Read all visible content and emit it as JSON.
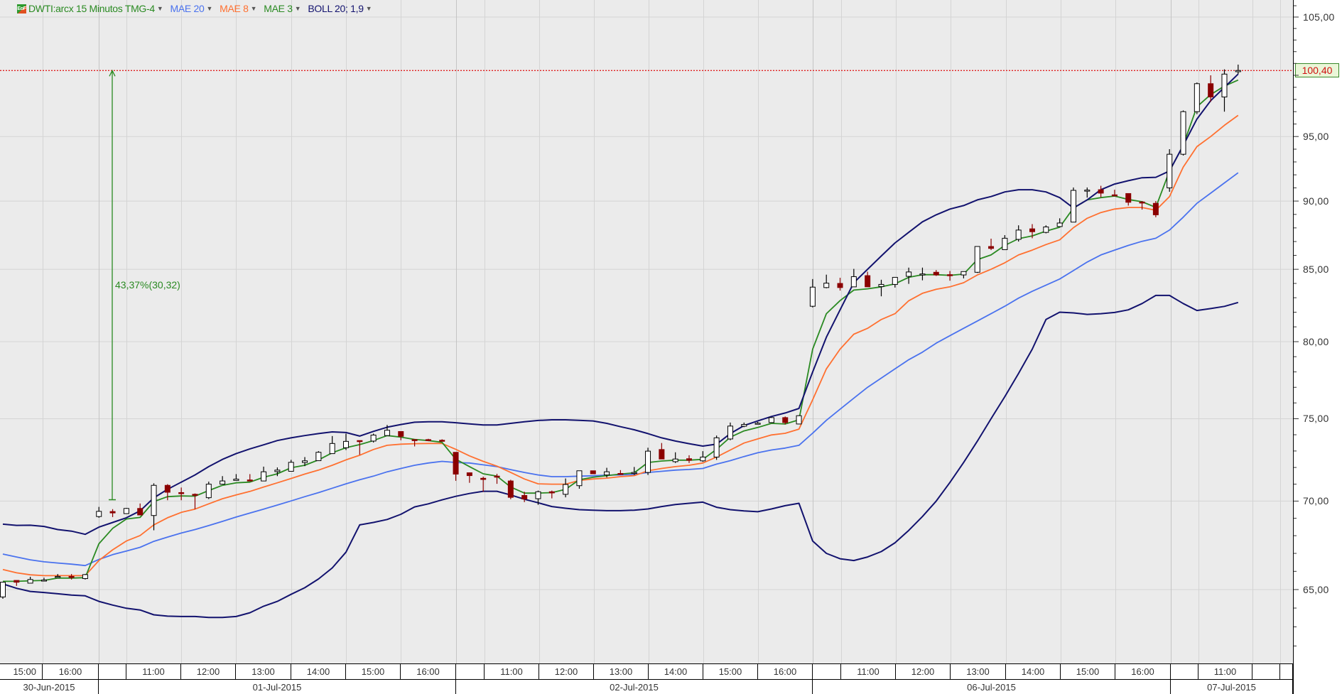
{
  "legend": {
    "symbol": "DWTI:arcx 15 Minutos TMG-4",
    "icon": "eof-logo-icon",
    "icon_text": "EoF",
    "indicators": [
      {
        "label": "MAE 20",
        "color": "#4a72ee"
      },
      {
        "label": "MAE 8",
        "color": "#ff7030"
      },
      {
        "label": "MAE 3",
        "color": "#2a8a22"
      },
      {
        "label": "BOLL 20; 1,9",
        "color": "#12126e"
      }
    ],
    "symbol_color": "#2a8a22"
  },
  "last_price": {
    "value": 100.4,
    "label": "100,40",
    "line_color": "#e02020"
  },
  "annotation": {
    "label": "43,37%(30,32)",
    "from": 70.08,
    "to": 100.4,
    "color": "#2a8a22"
  },
  "chart_data": {
    "type": "candlestick",
    "title": "DWTI:arcx 15 Minutos TMG-4",
    "yscale": "log",
    "ylim": [
      60.5,
      107.5
    ],
    "y_ticks": [
      105,
      100,
      95,
      90,
      85,
      80,
      75,
      70,
      65
    ],
    "y_tick_labels": [
      "105,00",
      "",
      "95,00",
      "90,00",
      "85,00",
      "80,00",
      "75,00",
      "70,00",
      "65,00"
    ],
    "grid": true,
    "x_hour_labels": [
      "15:00",
      "16:00",
      "",
      "11:00",
      "12:00",
      "13:00",
      "14:00",
      "15:00",
      "16:00",
      "",
      "11:00",
      "12:00",
      "13:00",
      "14:00",
      "15:00",
      "16:00",
      "",
      "11:00",
      "12:00",
      "13:00",
      "14:00",
      "15:00",
      "16:00",
      "",
      "11:00",
      "",
      ""
    ],
    "x_day_labels": [
      "30-Jun-2015",
      "01-Jul-2015",
      "02-Jul-2015",
      "06-Jul-2015",
      "07-Jul-2015",
      ""
    ],
    "candles_ohlc": [
      [
        64.6,
        65.4,
        64.5,
        65.4
      ],
      [
        65.5,
        65.5,
        65.2,
        65.4
      ],
      [
        65.35,
        65.7,
        65.35,
        65.55
      ],
      [
        65.5,
        65.65,
        65.48,
        65.52
      ],
      [
        65.7,
        65.85,
        65.65,
        65.72
      ],
      [
        65.72,
        65.85,
        65.55,
        65.68
      ],
      [
        65.6,
        65.85,
        65.55,
        65.82
      ],
      [
        69.1,
        69.66,
        69.03,
        69.4
      ],
      [
        69.39,
        69.53,
        69.07,
        69.31
      ],
      [
        69.27,
        69.6,
        69.25,
        69.57
      ],
      [
        69.57,
        69.86,
        69.19,
        69.19
      ],
      [
        69.16,
        71.05,
        68.31,
        70.93
      ],
      [
        70.93,
        71.0,
        70.05,
        70.52
      ],
      [
        70.5,
        70.8,
        70.05,
        70.45
      ],
      [
        70.4,
        70.45,
        69.53,
        70.35
      ],
      [
        70.2,
        71.15,
        70.12,
        71.0
      ],
      [
        71.0,
        71.48,
        71.0,
        71.19
      ],
      [
        71.22,
        71.6,
        71.2,
        71.3
      ],
      [
        71.25,
        71.6,
        71.22,
        71.22
      ],
      [
        71.19,
        72.05,
        71.19,
        71.74
      ],
      [
        71.75,
        72.0,
        71.48,
        71.84
      ],
      [
        71.77,
        72.46,
        71.77,
        72.31
      ],
      [
        72.3,
        72.63,
        72.08,
        72.4
      ],
      [
        72.41,
        72.99,
        72.4,
        72.92
      ],
      [
        72.84,
        73.92,
        72.84,
        73.46
      ],
      [
        73.2,
        74.07,
        73.06,
        73.59
      ],
      [
        73.64,
        73.64,
        72.77,
        73.58
      ],
      [
        73.61,
        74.07,
        73.52,
        73.98
      ],
      [
        73.95,
        74.61,
        73.95,
        74.28
      ],
      [
        74.2,
        74.2,
        73.66,
        73.9
      ],
      [
        73.7,
        73.72,
        73.28,
        73.64
      ],
      [
        73.7,
        73.75,
        73.6,
        73.68
      ],
      [
        73.66,
        73.72,
        73.58,
        73.62
      ],
      [
        72.92,
        72.92,
        71.2,
        71.6
      ],
      [
        71.68,
        71.7,
        71.08,
        71.51
      ],
      [
        71.35,
        71.45,
        70.55,
        71.28
      ],
      [
        71.48,
        71.62,
        71.02,
        71.47
      ],
      [
        71.19,
        71.26,
        70.11,
        70.22
      ],
      [
        70.33,
        70.55,
        69.94,
        70.12
      ],
      [
        70.14,
        70.62,
        69.78,
        70.55
      ],
      [
        70.55,
        70.62,
        70.16,
        70.48
      ],
      [
        70.4,
        71.34,
        70.22,
        70.98
      ],
      [
        70.91,
        71.8,
        70.73,
        71.8
      ],
      [
        71.8,
        71.8,
        71.6,
        71.62
      ],
      [
        71.55,
        71.98,
        71.4,
        71.74
      ],
      [
        71.64,
        71.84,
        71.55,
        71.62
      ],
      [
        71.69,
        72.03,
        71.55,
        71.7
      ],
      [
        71.7,
        73.2,
        71.55,
        72.99
      ],
      [
        73.09,
        73.49,
        72.51,
        72.51
      ],
      [
        72.35,
        72.92,
        72.27,
        72.51
      ],
      [
        72.53,
        72.74,
        72.27,
        72.43
      ],
      [
        72.4,
        72.99,
        72.34,
        72.63
      ],
      [
        72.63,
        73.95,
        72.46,
        73.81
      ],
      [
        73.74,
        74.76,
        73.66,
        74.54
      ],
      [
        74.53,
        74.76,
        74.47,
        74.64
      ],
      [
        74.7,
        74.8,
        74.64,
        74.72
      ],
      [
        74.76,
        75.1,
        74.76,
        75.07
      ],
      [
        75.07,
        75.14,
        74.64,
        74.76
      ],
      [
        74.67,
        75.22,
        74.65,
        75.19
      ],
      [
        82.41,
        84.31,
        82.33,
        83.74
      ],
      [
        83.71,
        84.62,
        83.66,
        84.02
      ],
      [
        84.0,
        84.4,
        83.5,
        83.71
      ],
      [
        83.76,
        85.03,
        83.76,
        84.48
      ],
      [
        84.55,
        84.83,
        83.76,
        83.76
      ],
      [
        83.78,
        84.26,
        83.1,
        83.93
      ],
      [
        83.93,
        84.43,
        83.71,
        84.43
      ],
      [
        84.5,
        85.12,
        83.97,
        84.81
      ],
      [
        84.65,
        85.12,
        84.22,
        84.67
      ],
      [
        84.79,
        84.95,
        84.53,
        84.6
      ],
      [
        84.62,
        84.88,
        84.19,
        84.6
      ],
      [
        84.6,
        84.84,
        84.36,
        84.84
      ],
      [
        84.79,
        86.64,
        84.74,
        86.64
      ],
      [
        86.64,
        87.21,
        86.38,
        86.5
      ],
      [
        86.41,
        87.47,
        86.41,
        87.24
      ],
      [
        87.16,
        88.19,
        87.0,
        87.84
      ],
      [
        87.93,
        88.28,
        87.24,
        87.72
      ],
      [
        87.67,
        88.19,
        87.6,
        88.07
      ],
      [
        88.1,
        88.71,
        88.1,
        88.36
      ],
      [
        88.43,
        91.03,
        88.43,
        90.81
      ],
      [
        90.8,
        91.03,
        90.26,
        90.83
      ],
      [
        90.86,
        91.16,
        90.29,
        90.6
      ],
      [
        90.47,
        90.86,
        90.4,
        90.45
      ],
      [
        90.57,
        90.57,
        89.66,
        89.91
      ],
      [
        89.93,
        90.0,
        89.36,
        89.9
      ],
      [
        89.83,
        90.0,
        88.79,
        88.97
      ],
      [
        91.0,
        94.0,
        90.7,
        93.6
      ],
      [
        93.6,
        97.1,
        93.5,
        97.0
      ],
      [
        97.0,
        99.4,
        96.8,
        99.3
      ],
      [
        99.3,
        100.0,
        97.8,
        98.2
      ],
      [
        98.2,
        100.5,
        97.0,
        100.1
      ],
      [
        100.3,
        100.9,
        100.1,
        100.4
      ]
    ],
    "candle_colors": {
      "up_fill": "#ffffff",
      "up_stroke": "#000000",
      "down": "#8b0000"
    },
    "series": [
      {
        "name": "MAE 20",
        "color": "#4a72ee",
        "values": [
          66.96,
          66.8,
          66.64,
          66.53,
          66.46,
          66.4,
          66.32,
          66.66,
          66.93,
          67.13,
          67.34,
          67.68,
          67.92,
          68.15,
          68.35,
          68.58,
          68.82,
          69.07,
          69.3,
          69.53,
          69.77,
          70.01,
          70.26,
          70.5,
          70.76,
          71.02,
          71.26,
          71.48,
          71.74,
          71.94,
          72.13,
          72.27,
          72.37,
          72.3,
          72.27,
          72.16,
          72.05,
          71.87,
          71.7,
          71.55,
          71.45,
          71.45,
          71.48,
          71.5,
          71.54,
          71.55,
          71.58,
          71.7,
          71.77,
          71.84,
          71.88,
          71.94,
          72.2,
          72.41,
          72.66,
          72.89,
          73.06,
          73.18,
          73.35,
          74.1,
          74.9,
          75.6,
          76.3,
          77.0,
          77.6,
          78.2,
          78.8,
          79.3,
          79.9,
          80.4,
          80.9,
          81.4,
          81.9,
          82.41,
          82.97,
          83.45,
          83.88,
          84.31,
          84.91,
          85.52,
          86.03,
          86.38,
          86.72,
          87.02,
          87.24,
          87.84,
          88.79,
          89.83,
          90.6,
          91.38,
          92.16
        ]
      },
      {
        "name": "MAE 8",
        "color": "#ff7030",
        "values": [
          66.1,
          65.92,
          65.81,
          65.76,
          65.76,
          65.76,
          65.76,
          66.6,
          67.2,
          67.7,
          68.01,
          68.62,
          69.03,
          69.34,
          69.53,
          69.84,
          70.14,
          70.36,
          70.57,
          70.83,
          71.08,
          71.34,
          71.6,
          71.84,
          72.13,
          72.46,
          72.74,
          73.09,
          73.35,
          73.42,
          73.45,
          73.46,
          73.46,
          73.1,
          72.7,
          72.37,
          72.08,
          71.7,
          71.31,
          71.02,
          71.0,
          71.0,
          71.22,
          71.31,
          71.36,
          71.45,
          71.51,
          71.8,
          71.94,
          72.05,
          72.13,
          72.27,
          72.63,
          73.06,
          73.49,
          73.74,
          73.99,
          74.09,
          74.35,
          76.2,
          78.2,
          79.5,
          80.5,
          80.9,
          81.5,
          81.9,
          82.79,
          83.31,
          83.59,
          83.76,
          84.05,
          84.6,
          85.0,
          85.47,
          86.03,
          86.38,
          86.78,
          87.12,
          88.02,
          88.71,
          89.14,
          89.4,
          89.52,
          89.52,
          89.31,
          90.34,
          92.6,
          94.2,
          95.0,
          95.9,
          96.7
        ]
      },
      {
        "name": "MAE 3",
        "color": "#2a8a22",
        "values": [
          65.45,
          65.45,
          65.48,
          65.5,
          65.63,
          65.63,
          65.65,
          67.54,
          68.42,
          68.96,
          69.05,
          69.97,
          70.26,
          70.3,
          70.29,
          70.62,
          70.93,
          71.08,
          71.12,
          71.41,
          71.62,
          71.98,
          72.13,
          72.46,
          72.89,
          73.2,
          73.39,
          73.64,
          73.95,
          73.85,
          73.71,
          73.64,
          73.53,
          72.5,
          72.05,
          71.62,
          71.48,
          70.83,
          70.47,
          70.47,
          70.5,
          70.69,
          71.26,
          71.41,
          71.51,
          71.6,
          71.68,
          72.3,
          72.39,
          72.44,
          72.44,
          72.49,
          73.1,
          73.85,
          74.24,
          74.45,
          74.71,
          74.67,
          74.93,
          79.5,
          81.9,
          82.8,
          83.53,
          83.62,
          83.76,
          83.97,
          84.43,
          84.62,
          84.62,
          84.57,
          84.66,
          85.69,
          86.03,
          86.72,
          87.21,
          87.41,
          87.76,
          88.05,
          89.48,
          90.09,
          90.26,
          90.38,
          90.12,
          89.95,
          89.53,
          92.3,
          94.3,
          97.4,
          98.4,
          99.1,
          99.6
        ]
      },
      {
        "name": "BOLL 20; 1,9 upper",
        "color": "#12126e",
        "values": [
          68.66,
          68.59,
          68.6,
          68.53,
          68.35,
          68.26,
          68.08,
          68.49,
          68.76,
          69.03,
          69.43,
          70.19,
          70.69,
          71.12,
          71.55,
          72.05,
          72.49,
          72.84,
          73.13,
          73.38,
          73.64,
          73.81,
          73.95,
          74.07,
          74.18,
          74.14,
          73.92,
          74.21,
          74.47,
          74.64,
          74.78,
          74.81,
          74.81,
          74.75,
          74.68,
          74.61,
          74.61,
          74.71,
          74.81,
          74.89,
          74.93,
          74.93,
          74.9,
          74.86,
          74.71,
          74.5,
          74.31,
          74.07,
          73.81,
          73.61,
          73.45,
          73.3,
          73.42,
          74.07,
          74.57,
          74.86,
          75.14,
          75.36,
          75.65,
          78.0,
          80.3,
          82.16,
          84.05,
          85.0,
          85.95,
          86.9,
          87.67,
          88.45,
          88.97,
          89.4,
          89.66,
          90.09,
          90.34,
          90.69,
          90.86,
          90.86,
          90.69,
          90.26,
          89.48,
          90.09,
          90.86,
          91.29,
          91.55,
          91.78,
          91.81,
          92.3,
          94.3,
          96.4,
          97.9,
          99.0,
          100.1
        ]
      },
      {
        "name": "BOLL 20; 1,9 lower",
        "color": "#12126e",
        "values": [
          65.31,
          65.07,
          64.9,
          64.84,
          64.77,
          64.7,
          64.66,
          64.36,
          64.16,
          63.99,
          63.9,
          63.64,
          63.57,
          63.55,
          63.55,
          63.5,
          63.5,
          63.55,
          63.75,
          64.1,
          64.36,
          64.74,
          65.1,
          65.58,
          66.19,
          67.07,
          68.62,
          68.76,
          68.93,
          69.23,
          69.66,
          69.84,
          70.07,
          70.28,
          70.45,
          70.58,
          70.58,
          70.36,
          70.11,
          69.9,
          69.68,
          69.58,
          69.5,
          69.47,
          69.44,
          69.44,
          69.47,
          69.54,
          69.68,
          69.8,
          69.87,
          69.94,
          69.64,
          69.5,
          69.43,
          69.38,
          69.54,
          69.73,
          69.87,
          67.7,
          67.0,
          66.7,
          66.6,
          66.8,
          67.1,
          67.6,
          68.3,
          69.1,
          70.0,
          71.1,
          72.3,
          73.6,
          75.0,
          76.4,
          77.9,
          79.5,
          81.5,
          82.0,
          81.95,
          81.85,
          81.9,
          81.98,
          82.16,
          82.6,
          83.16,
          83.16,
          82.6,
          82.12,
          82.25,
          82.4,
          82.67
        ]
      }
    ]
  }
}
